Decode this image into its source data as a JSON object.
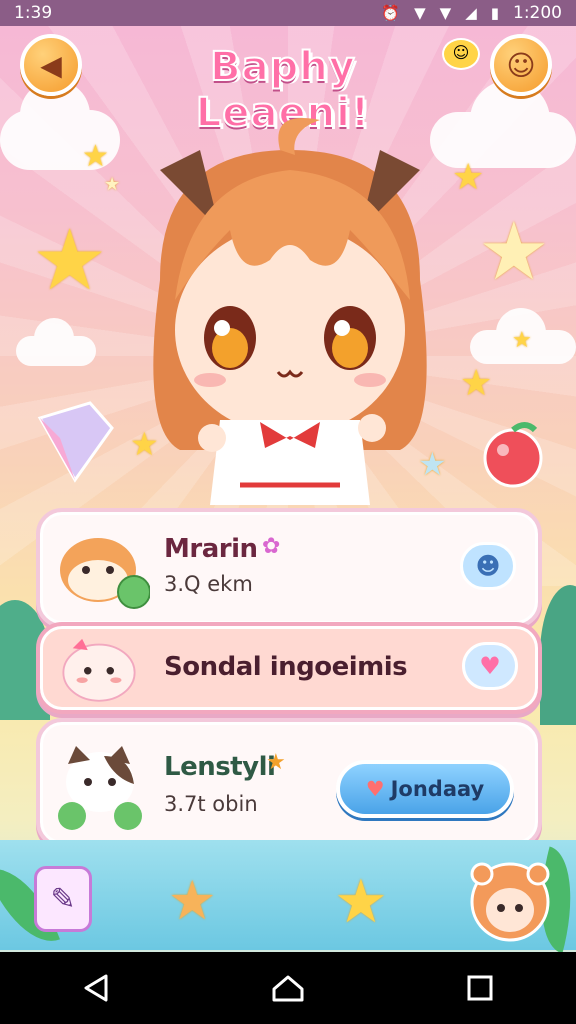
{
  "status_bar": {
    "time": "1:39",
    "clock_right": "1:200"
  },
  "header": {
    "title": "Baphy Leaeni!",
    "back_icon": "back-arrow-icon",
    "profile_icon": "happy-face-icon"
  },
  "list": [
    {
      "name": "Mrarin",
      "meta": "3.Q ekm",
      "badge_icon": "flower-icon",
      "action_icon": "cat-face-icon"
    },
    {
      "name": "Sondal ingoeimis",
      "action_icon": "heart-bubble-icon"
    },
    {
      "name": "Lenstyli",
      "meta": "3.7t obin",
      "badge_icon": "star-icon",
      "button_label": "Jondaay"
    }
  ],
  "nav": {
    "back": "back-nav-icon",
    "home": "home-nav-icon",
    "recents": "recents-nav-icon"
  },
  "colors": {
    "accent": "#ff6fa7",
    "button_blue": "#4aa3e8",
    "status_bar": "#8b5d87"
  }
}
